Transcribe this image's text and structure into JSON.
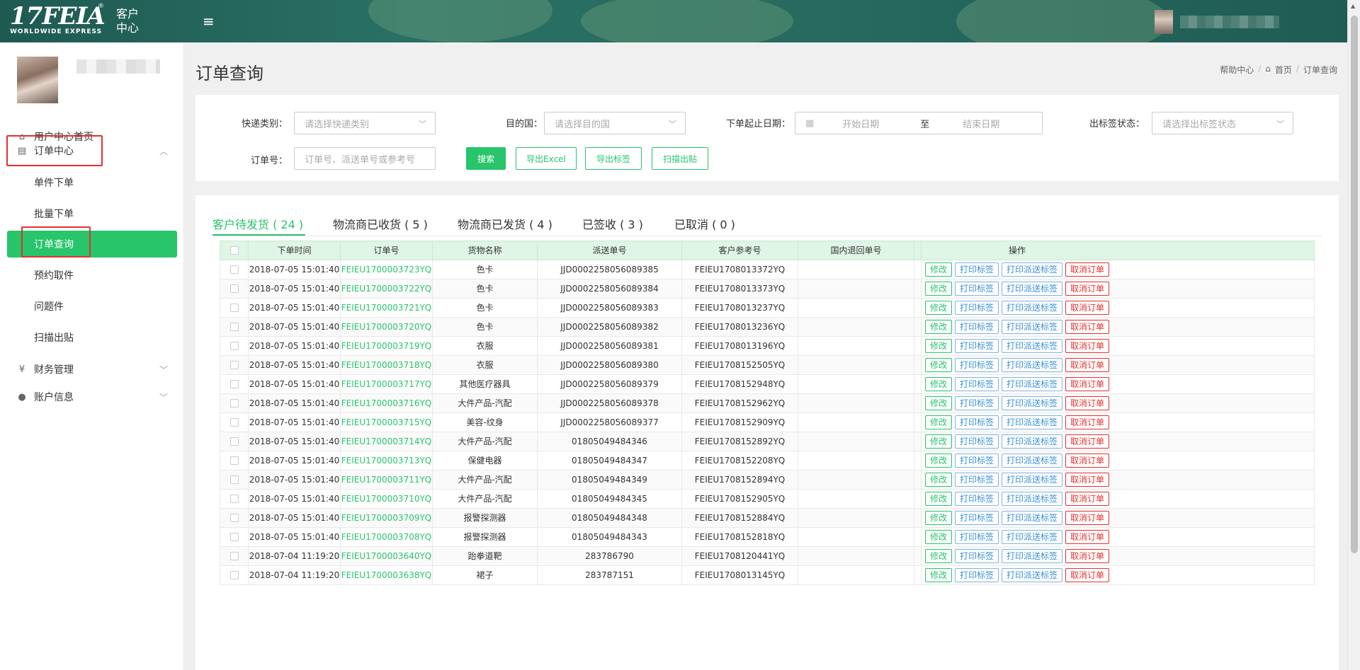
{
  "header": {
    "logo_text": "17FEIA",
    "logo_sub": "WORLDWIDE EXPRESS",
    "logo_reg": "®",
    "center_title_line1": "客户",
    "center_title_line2": "中心",
    "menu_icon": "≡"
  },
  "sidebar": {
    "menu": [
      {
        "label": "用户中心首页",
        "icon": "home-icon"
      },
      {
        "label": "订单中心",
        "icon": "document-icon"
      },
      {
        "label": "财务管理",
        "icon": "yen-icon"
      },
      {
        "label": "账户信息",
        "icon": "user-icon"
      }
    ],
    "order_sub": [
      "单件下单",
      "批量下单",
      "订单查询",
      "预约取件",
      "问题件",
      "扫描出贴"
    ],
    "active_sub": "订单查询"
  },
  "page": {
    "title": "订单查询",
    "breadcrumb": [
      "帮助中心",
      "首页",
      "订单查询"
    ]
  },
  "filter": {
    "express_type_label": "快递类别：",
    "express_type_placeholder": "请选择快递类别",
    "dest_label": "目的国：",
    "dest_placeholder": "请选择目的国",
    "date_label": "下单起止日期：",
    "date_start": "开始日期",
    "date_sep": "至",
    "date_end": "结束日期",
    "label_status_label": "出标签状态：",
    "label_status_placeholder": "请选择出标签状态",
    "order_no_label": "订单号：",
    "order_no_placeholder": "订单号、派送单号或参考号",
    "search_btn": "搜索",
    "export_excel_btn": "导出Excel",
    "export_label_btn": "导出标签",
    "scan_btn": "扫描出贴"
  },
  "tabs": [
    {
      "label": "客户待发货 ( 24 )"
    },
    {
      "label": "物流商已收货 ( 5 )"
    },
    {
      "label": "物流商已发货 ( 4 )"
    },
    {
      "label": "已签收 ( 3 )"
    },
    {
      "label": "已取消 ( 0 )"
    }
  ],
  "table": {
    "headers": [
      "下单时间",
      "订单号",
      "货物名称",
      "派送单号",
      "客户参考号",
      "国内退回单号",
      "操作"
    ],
    "op_labels": {
      "edit": "修改",
      "print_label": "打印标签",
      "print_delivery": "打印派送标签",
      "cancel": "取消订单"
    },
    "rows": [
      [
        "2018-07-05 15:01:40",
        "FEIEU1700003723YQ",
        "色卡",
        "JJD0002258056089385",
        "FEIEU1708013372YQ",
        ""
      ],
      [
        "2018-07-05 15:01:40",
        "FEIEU1700003722YQ",
        "色卡",
        "JJD0002258056089384",
        "FEIEU1708013373YQ",
        ""
      ],
      [
        "2018-07-05 15:01:40",
        "FEIEU1700003721YQ",
        "色卡",
        "JJD0002258056089383",
        "FEIEU1708013237YQ",
        ""
      ],
      [
        "2018-07-05 15:01:40",
        "FEIEU1700003720YQ",
        "色卡",
        "JJD0002258056089382",
        "FEIEU1708013236YQ",
        ""
      ],
      [
        "2018-07-05 15:01:40",
        "FEIEU1700003719YQ",
        "衣服",
        "JJD0002258056089381",
        "FEIEU1708013196YQ",
        ""
      ],
      [
        "2018-07-05 15:01:40",
        "FEIEU1700003718YQ",
        "衣服",
        "JJD0002258056089380",
        "FEIEU1708152505YQ",
        ""
      ],
      [
        "2018-07-05 15:01:40",
        "FEIEU1700003717YQ",
        "其他医疗器具",
        "JJD0002258056089379",
        "FEIEU1708152948YQ",
        ""
      ],
      [
        "2018-07-05 15:01:40",
        "FEIEU1700003716YQ",
        "大件产品-汽配",
        "JJD0002258056089378",
        "FEIEU1708152962YQ",
        ""
      ],
      [
        "2018-07-05 15:01:40",
        "FEIEU1700003715YQ",
        "美容-纹身",
        "JJD0002258056089377",
        "FEIEU1708152909YQ",
        ""
      ],
      [
        "2018-07-05 15:01:40",
        "FEIEU1700003714YQ",
        "大件产品-汽配",
        "01805049484346",
        "FEIEU1708152892YQ",
        ""
      ],
      [
        "2018-07-05 15:01:40",
        "FEIEU1700003713YQ",
        "保健电器",
        "01805049484347",
        "FEIEU1708152208YQ",
        ""
      ],
      [
        "2018-07-05 15:01:40",
        "FEIEU1700003711YQ",
        "大件产品-汽配",
        "01805049484349",
        "FEIEU1708152894YQ",
        ""
      ],
      [
        "2018-07-05 15:01:40",
        "FEIEU1700003710YQ",
        "大件产品-汽配",
        "01805049484345",
        "FEIEU1708152905YQ",
        ""
      ],
      [
        "2018-07-05 15:01:40",
        "FEIEU1700003709YQ",
        "报警探测器",
        "01805049484348",
        "FEIEU1708152884YQ",
        ""
      ],
      [
        "2018-07-05 15:01:40",
        "FEIEU1700003708YQ",
        "报警探测器",
        "01805049484343",
        "FEIEU1708152818YQ",
        ""
      ],
      [
        "2018-07-04 11:19:20",
        "FEIEU1700003640YQ",
        "跆拳道靶",
        "283786790",
        "FEIEU1708120441YQ",
        ""
      ],
      [
        "2018-07-04 11:19:20",
        "FEIEU1700003638YQ",
        "裙子",
        "283787151",
        "FEIEU1708013145YQ",
        ""
      ]
    ]
  },
  "colors": {
    "accent": "#28c56b",
    "header_bg": "#276a5f",
    "danger": "#e5312f",
    "info": "#3b8fd6"
  }
}
